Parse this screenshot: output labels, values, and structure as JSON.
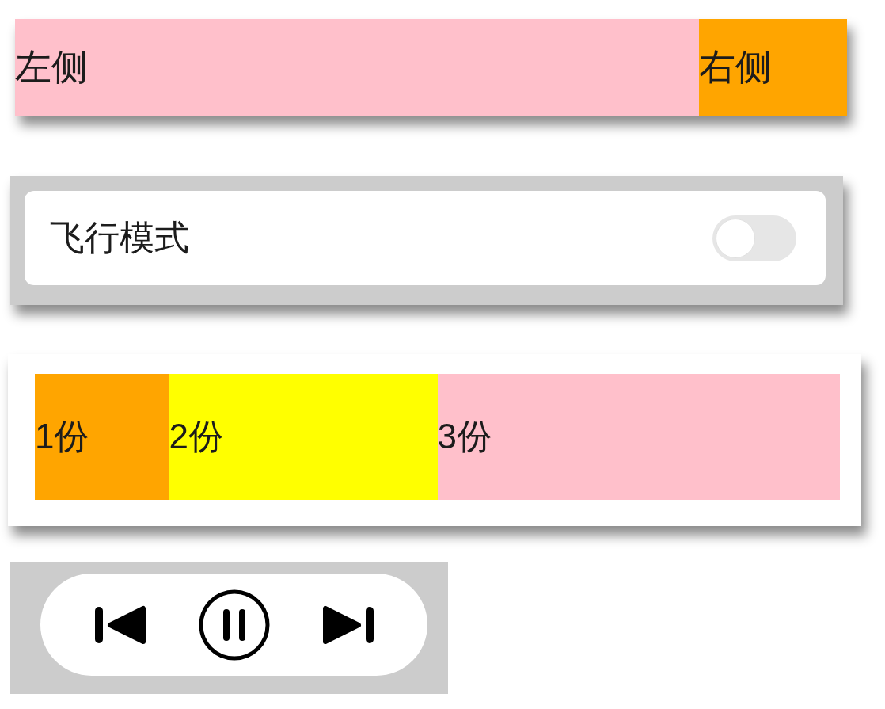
{
  "split_bar": {
    "sections": [
      {
        "label": "左侧",
        "color": "#ffc0cb"
      },
      {
        "label": "右侧",
        "color": "#ffa500"
      }
    ]
  },
  "setting": {
    "label": "飞行模式",
    "on": false
  },
  "ratio_bar": {
    "sections": [
      {
        "label": "1份",
        "color": "#ffa500"
      },
      {
        "label": "2份",
        "color": "#ffff00"
      },
      {
        "label": "3份",
        "color": "#ffc0cb"
      }
    ]
  },
  "media_controls": {
    "buttons": [
      {
        "kind": "previous"
      },
      {
        "kind": "pause"
      },
      {
        "kind": "next"
      }
    ]
  }
}
